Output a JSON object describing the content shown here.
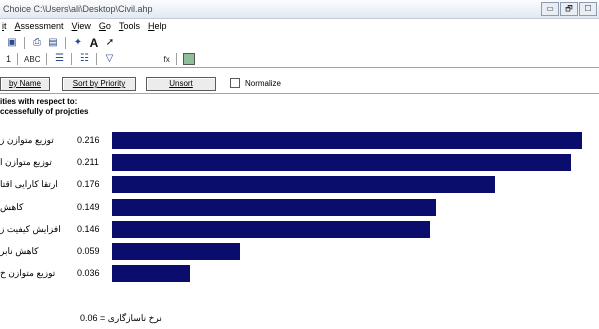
{
  "window": {
    "title": "Choice   C:\\Users\\ali\\Desktop\\Civil.ahp",
    "buttons": [
      "▭",
      "🗗",
      "☐"
    ]
  },
  "menu": [
    "it",
    "Assessment",
    "View",
    "Go",
    "Tools",
    "Help"
  ],
  "toolbar": {
    "row2_text1": "1",
    "row2_text2": "ABC",
    "row2_text3": "fx"
  },
  "sortbar": {
    "sort_by_name": "by Name",
    "sort_by_priority": "Sort by Priority",
    "unsort": "Unsort",
    "normalize": "Normalize"
  },
  "header": {
    "line1": "ities with respect to:",
    "line2": "ccessefully of projcties"
  },
  "chart_data": {
    "type": "bar",
    "categories": [
      "توزیع متوازن ز",
      "توزیع متوازن ا",
      "ارتقا کارایی اقتا",
      "کاهش",
      "افزایش کیفیت ز",
      "کاهش نابر",
      "توزیع متوازن خ"
    ],
    "values": [
      0.216,
      0.211,
      0.176,
      0.149,
      0.146,
      0.059,
      0.036
    ],
    "value_labels": [
      "0.216",
      "0.211",
      "0.176",
      "0.149",
      "0.146",
      "0.059",
      "0.036"
    ],
    "bar_color": "#0a0d6b",
    "xlim": [
      0,
      0.22
    ]
  },
  "inconsistency": "نرخ ناسازگاری = 0.06",
  "colors": {
    "bar": "#0a0d6b",
    "title_bg": "#e8edf5"
  }
}
